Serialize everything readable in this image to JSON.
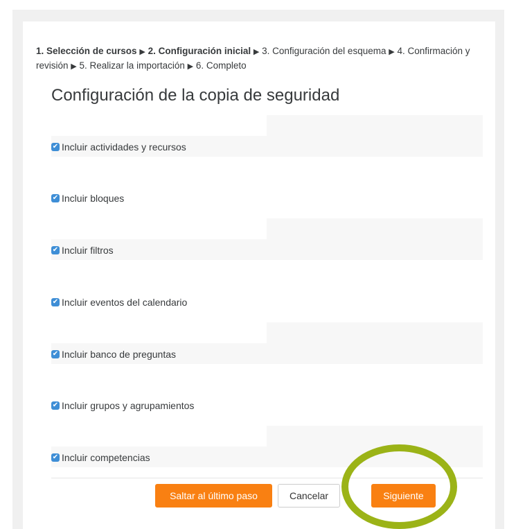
{
  "breadcrumb": {
    "step1": "1. Selección de cursos",
    "step2": "2. Configuración inicial",
    "step3": "3. Configuración del esquema",
    "step4": "4. Confirmación y revisión",
    "step5": "5. Realizar la importación",
    "step6": "6. Completo",
    "separator": "▶"
  },
  "section": {
    "title": "Configuración de la copia de seguridad"
  },
  "options": [
    {
      "label": "Incluir actividades y recursos",
      "checked": true
    },
    {
      "label": "Incluir bloques",
      "checked": true
    },
    {
      "label": "Incluir filtros",
      "checked": true
    },
    {
      "label": "Incluir eventos del calendario",
      "checked": true
    },
    {
      "label": "Incluir banco de preguntas",
      "checked": true
    },
    {
      "label": "Incluir grupos y agrupamientos",
      "checked": true
    },
    {
      "label": "Incluir competencias",
      "checked": true
    }
  ],
  "buttons": {
    "skip": "Saltar al último paso",
    "cancel": "Cancelar",
    "next": "Siguiente"
  },
  "colors": {
    "accent": "#f98012",
    "checkbox": "#3e8ed6",
    "highlight": "#9bb317"
  },
  "icons": {
    "check": "checkbox-checked-icon"
  }
}
